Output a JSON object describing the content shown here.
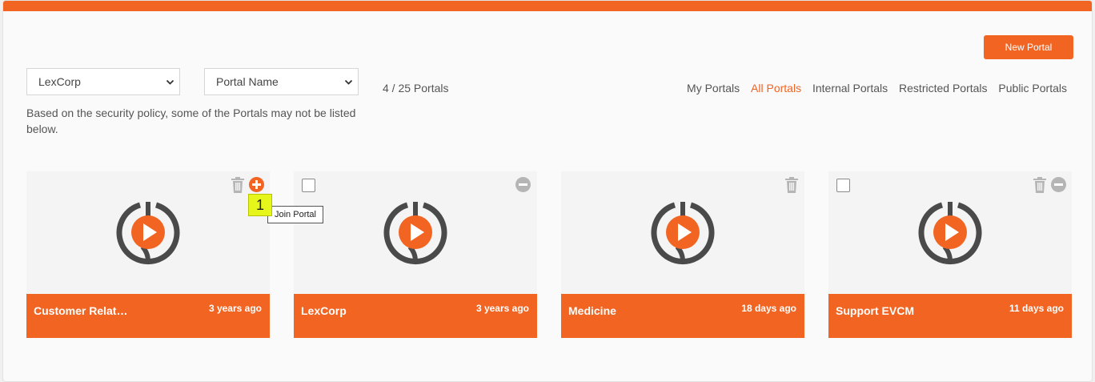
{
  "toolbar": {
    "new_portal_label": "New Portal"
  },
  "filters": {
    "company_value": "LexCorp",
    "sort_value": "Portal Name",
    "count_text": "4 / 25 Portals",
    "tabs": [
      "My Portals",
      "All Portals",
      "Internal Portals",
      "Restricted Portals",
      "Public Portals"
    ],
    "active_tab": "All Portals"
  },
  "notice": "Based on the security policy, some of the Portals may not be listed below.",
  "colors": {
    "accent": "#f26422",
    "icon_gray": "#b5b5b5",
    "badge": "#e6f51a"
  },
  "portals": [
    {
      "title": "Customer Relat…",
      "date": "3 years ago",
      "has_checkbox": false,
      "has_trash": true,
      "action": "join-icon"
    },
    {
      "title": "LexCorp",
      "date": "3 years ago",
      "has_checkbox": true,
      "has_trash": false,
      "action": "leave-icon"
    },
    {
      "title": "Medicine",
      "date": "18 days ago",
      "has_checkbox": false,
      "has_trash": true,
      "action": "none"
    },
    {
      "title": "Support EVCM",
      "date": "11 days ago",
      "has_checkbox": true,
      "has_trash": true,
      "action": "leave-icon"
    }
  ],
  "annotation": {
    "badge_number": "1",
    "tooltip_text": "Join Portal"
  }
}
